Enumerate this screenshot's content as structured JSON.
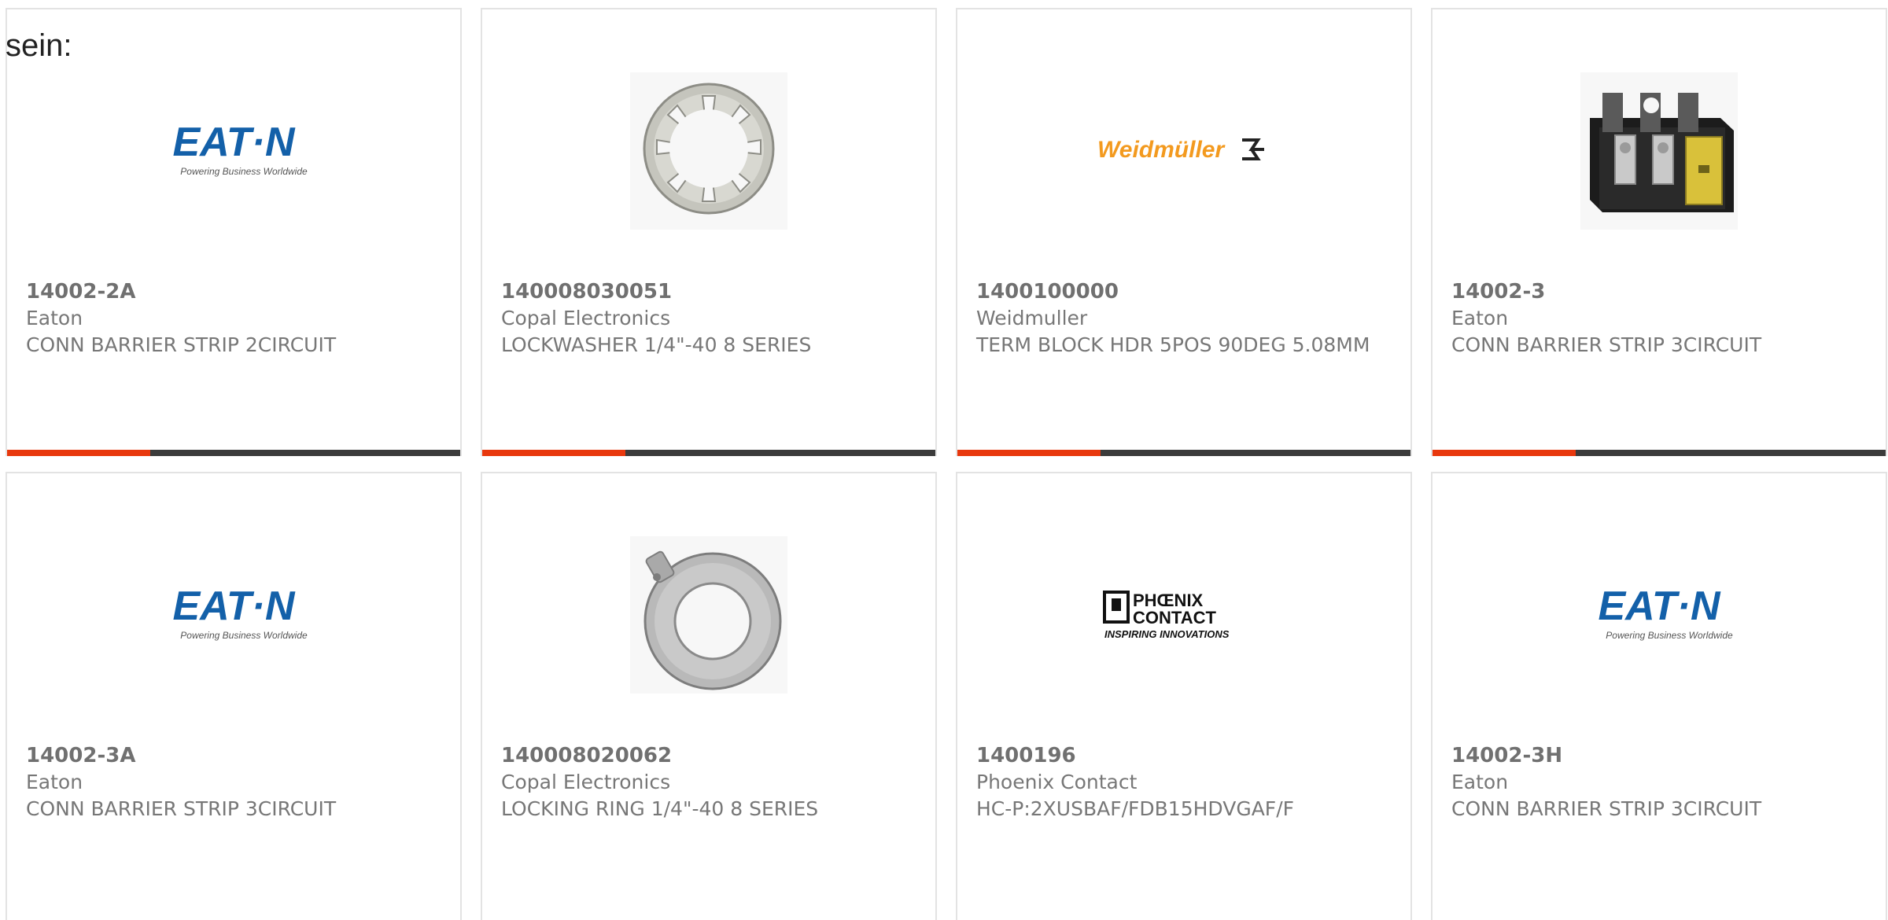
{
  "intro_text": "sein:",
  "accent_color": "#e8380d",
  "bar_color": "#3b3b3b",
  "eaton_logo": {
    "wordmark": "EAT·N",
    "tagline": "Powering Business Worldwide",
    "color": "#1360a9"
  },
  "weidmuller_logo": {
    "wordmark": "Weidmüller",
    "color": "#f39a1f"
  },
  "phoenix_logo": {
    "wordmark1": "PHŒNIX",
    "wordmark2": "CONTACT",
    "tagline": "INSPIRING INNOVATIONS"
  },
  "products": [
    {
      "part": "14002-2A",
      "maker": "Eaton",
      "desc": "CONN BARRIER STRIP 2CIRCUIT",
      "image": "eaton-logo"
    },
    {
      "part": "140008030051",
      "maker": "Copal Electronics",
      "desc": "LOCKWASHER 1/4\"-40 8 SERIES",
      "image": "lockwasher-photo"
    },
    {
      "part": "1400100000",
      "maker": "Weidmuller",
      "desc": "TERM BLOCK HDR 5POS 90DEG 5.08MM",
      "image": "weidmuller-logo"
    },
    {
      "part": "14002-3",
      "maker": "Eaton",
      "desc": "CONN BARRIER STRIP 3CIRCUIT",
      "image": "barrier-strip-photo"
    },
    {
      "part": "14002-3A",
      "maker": "Eaton",
      "desc": "CONN BARRIER STRIP 3CIRCUIT",
      "image": "eaton-logo"
    },
    {
      "part": "140008020062",
      "maker": "Copal Electronics",
      "desc": "LOCKING RING 1/4\"-40 8 SERIES",
      "image": "locking-ring-photo"
    },
    {
      "part": "1400196",
      "maker": "Phoenix Contact",
      "desc": "HC-P:2XUSBAF/FDB15HDVGAF/F",
      "image": "phoenix-logo"
    },
    {
      "part": "14002-3H",
      "maker": "Eaton",
      "desc": "CONN BARRIER STRIP 3CIRCUIT",
      "image": "eaton-logo"
    }
  ]
}
